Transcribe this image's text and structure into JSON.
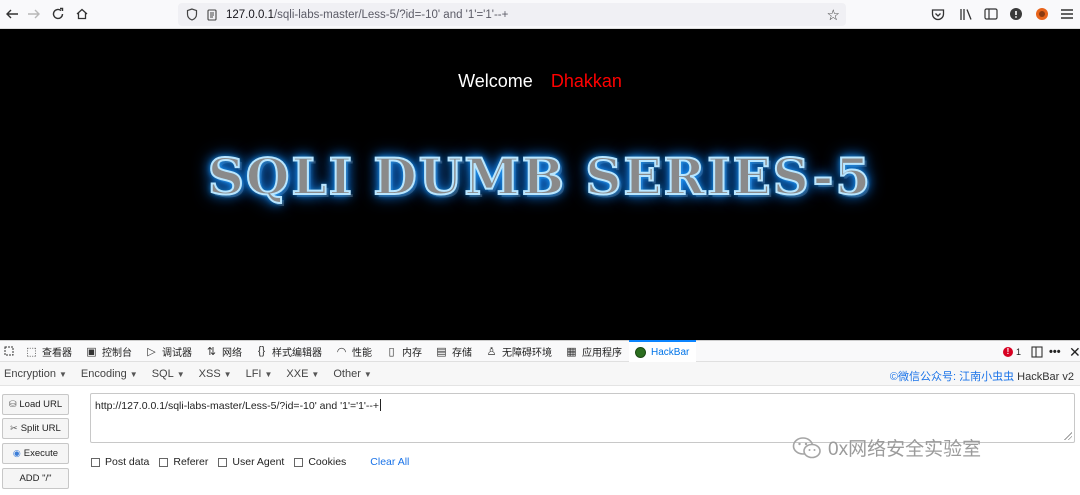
{
  "browser": {
    "url_host": "127.0.0.1",
    "url_rest": "/sqli-labs-master/Less-5/?id=-10' and '1'='1'--+"
  },
  "page": {
    "welcome": "Welcome",
    "name": "Dhakkan",
    "title": "SQLI DUMB SERIES-5"
  },
  "devtools": {
    "tabs": [
      {
        "label": "查看器",
        "icon": "inspector-icon"
      },
      {
        "label": "控制台",
        "icon": "console-icon"
      },
      {
        "label": "调试器",
        "icon": "debugger-icon"
      },
      {
        "label": "网络",
        "icon": "network-icon"
      },
      {
        "label": "样式编辑器",
        "icon": "style-editor-icon"
      },
      {
        "label": "性能",
        "icon": "performance-icon"
      },
      {
        "label": "内存",
        "icon": "memory-icon"
      },
      {
        "label": "存储",
        "icon": "storage-icon"
      },
      {
        "label": "无障碍环境",
        "icon": "accessibility-icon"
      },
      {
        "label": "应用程序",
        "icon": "application-icon"
      },
      {
        "label": "HackBar",
        "icon": "hackbar-icon"
      }
    ],
    "error_count": "1"
  },
  "hackbar": {
    "menu": [
      "Encryption",
      "Encoding",
      "SQL",
      "XSS",
      "LFI",
      "XXE",
      "Other"
    ],
    "credit_prefix": "©微信公众号: ",
    "credit_name": "江南小虫虫",
    "credit_suffix": " HackBar v2",
    "buttons": {
      "load": "Load URL",
      "split": "Split URL",
      "execute": "Execute",
      "add": "ADD \"/\""
    },
    "url_value": "http://127.0.0.1/sqli-labs-master/Less-5/?id=-10' and '1'='1'--+",
    "checkboxes": [
      "Post data",
      "Referer",
      "User Agent",
      "Cookies"
    ],
    "clear_all": "Clear All"
  },
  "watermark": "0x网络安全实验室"
}
